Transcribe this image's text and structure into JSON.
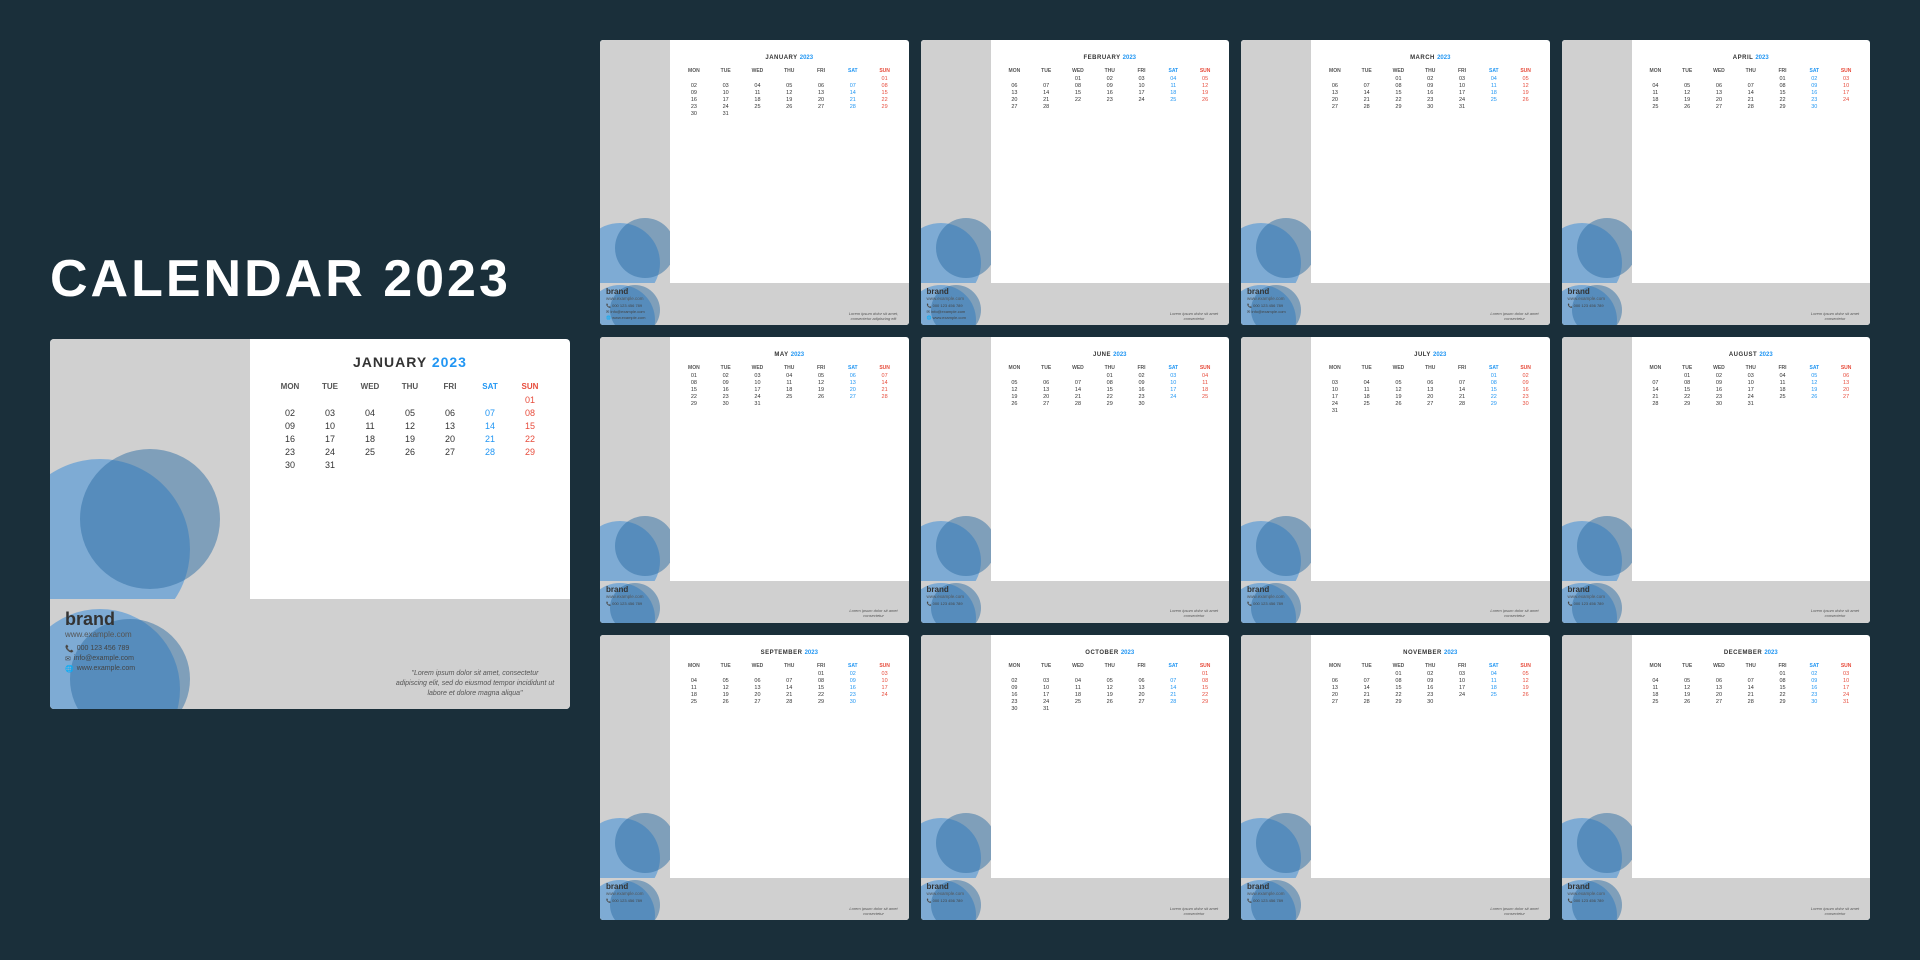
{
  "title": "CALENDAR 2023",
  "brand": {
    "name": "brand",
    "website": "www.example.com",
    "phone": "000 123 456 789",
    "email": "info@example.com",
    "web2": "www.example.com"
  },
  "quote": "\"Lorem ipsum dolor sit amet, consectetur adipiscing elit, sed do eiusmod tempor incididunt ut labore et dolore magna aliqua\"",
  "months": [
    {
      "name": "JANUARY",
      "year": "2023",
      "days": [
        "",
        "",
        "",
        "",
        "",
        "",
        "01",
        "02",
        "03",
        "04",
        "05",
        "06",
        "07",
        "08",
        "09",
        "10",
        "11",
        "12",
        "13",
        "14",
        "15",
        "16",
        "17",
        "18",
        "19",
        "20",
        "21",
        "22",
        "23",
        "24",
        "25",
        "26",
        "27",
        "28",
        "29",
        "30",
        "31",
        "",
        "",
        "",
        "",
        "",
        "",
        ""
      ]
    },
    {
      "name": "FEBRUARY",
      "year": "2023",
      "days": [
        "",
        "",
        "01",
        "02",
        "03",
        "04",
        "05",
        "06",
        "07",
        "08",
        "09",
        "10",
        "11",
        "12",
        "13",
        "14",
        "15",
        "16",
        "17",
        "18",
        "19",
        "20",
        "21",
        "22",
        "23",
        "24",
        "25",
        "26",
        "27",
        "28",
        "",
        "",
        "",
        "",
        "",
        "",
        ""
      ]
    },
    {
      "name": "MARCH",
      "year": "2023",
      "days": [
        "",
        "",
        "01",
        "02",
        "03",
        "04",
        "05",
        "06",
        "07",
        "08",
        "09",
        "10",
        "11",
        "12",
        "13",
        "14",
        "15",
        "16",
        "17",
        "18",
        "19",
        "20",
        "21",
        "22",
        "23",
        "24",
        "25",
        "26",
        "27",
        "28",
        "29",
        "30",
        "31",
        "",
        "",
        "",
        ""
      ]
    },
    {
      "name": "APRIL",
      "year": "2023",
      "days": [
        "",
        "",
        "",
        "",
        "",
        "01",
        "02",
        "03",
        "04",
        "05",
        "06",
        "07",
        "08",
        "09",
        "10",
        "11",
        "12",
        "13",
        "14",
        "15",
        "16",
        "17",
        "18",
        "19",
        "20",
        "21",
        "22",
        "23",
        "24",
        "25",
        "26",
        "27",
        "28",
        "29",
        "30",
        "",
        ""
      ]
    },
    {
      "name": "MAY",
      "year": "2023",
      "days": [
        "01",
        "02",
        "03",
        "04",
        "05",
        "06",
        "07",
        "08",
        "09",
        "10",
        "11",
        "12",
        "13",
        "14",
        "15",
        "16",
        "17",
        "18",
        "19",
        "20",
        "21",
        "22",
        "23",
        "24",
        "25",
        "26",
        "27",
        "28",
        "29",
        "30",
        "31",
        "",
        "",
        "",
        "",
        "",
        ""
      ]
    },
    {
      "name": "JUNE",
      "year": "2023",
      "days": [
        "",
        "",
        "",
        "01",
        "02",
        "03",
        "04",
        "05",
        "06",
        "07",
        "08",
        "09",
        "10",
        "11",
        "12",
        "13",
        "14",
        "15",
        "16",
        "17",
        "18",
        "19",
        "20",
        "21",
        "22",
        "23",
        "24",
        "25",
        "26",
        "27",
        "28",
        "29",
        "30",
        "",
        "",
        "",
        ""
      ]
    },
    {
      "name": "JULY",
      "year": "2023",
      "days": [
        "",
        "",
        "",
        "",
        "",
        "01",
        "02",
        "03",
        "04",
        "05",
        "06",
        "07",
        "08",
        "09",
        "10",
        "11",
        "12",
        "13",
        "14",
        "15",
        "16",
        "17",
        "18",
        "19",
        "20",
        "21",
        "22",
        "23",
        "24",
        "25",
        "26",
        "27",
        "28",
        "29",
        "30",
        "31"
      ]
    },
    {
      "name": "AUGUST",
      "year": "2023",
      "days": [
        "",
        "01",
        "02",
        "03",
        "04",
        "05",
        "06",
        "07",
        "08",
        "09",
        "10",
        "11",
        "12",
        "13",
        "14",
        "15",
        "16",
        "17",
        "18",
        "19",
        "20",
        "21",
        "22",
        "23",
        "24",
        "25",
        "26",
        "27",
        "28",
        "29",
        "30",
        "31",
        "",
        "",
        "",
        "",
        ""
      ]
    },
    {
      "name": "SEPTEMBER",
      "year": "2023",
      "days": [
        "",
        "",
        "",
        "",
        "01",
        "02",
        "03",
        "04",
        "05",
        "06",
        "07",
        "08",
        "09",
        "10",
        "11",
        "12",
        "13",
        "14",
        "15",
        "16",
        "17",
        "18",
        "19",
        "20",
        "21",
        "22",
        "23",
        "24",
        "25",
        "26",
        "27",
        "28",
        "29",
        "30",
        "",
        "",
        ""
      ]
    },
    {
      "name": "OCTOBER",
      "year": "2023",
      "days": [
        "",
        "",
        "",
        "",
        "",
        "",
        "01",
        "02",
        "03",
        "04",
        "05",
        "06",
        "07",
        "08",
        "09",
        "10",
        "11",
        "12",
        "13",
        "14",
        "15",
        "16",
        "17",
        "18",
        "19",
        "20",
        "21",
        "22",
        "23",
        "24",
        "25",
        "26",
        "27",
        "28",
        "29",
        "30",
        "31"
      ]
    },
    {
      "name": "NOVEMBER",
      "year": "2023",
      "days": [
        "",
        "",
        "01",
        "02",
        "03",
        "04",
        "05",
        "06",
        "07",
        "08",
        "09",
        "10",
        "11",
        "12",
        "13",
        "14",
        "15",
        "16",
        "17",
        "18",
        "19",
        "20",
        "21",
        "22",
        "23",
        "24",
        "25",
        "26",
        "27",
        "28",
        "29",
        "30",
        "",
        "",
        "",
        "",
        ""
      ]
    },
    {
      "name": "DECEMBER",
      "year": "2023",
      "days": [
        "",
        "",
        "",
        "",
        "01",
        "02",
        "03",
        "04",
        "05",
        "06",
        "07",
        "08",
        "09",
        "10",
        "11",
        "12",
        "13",
        "14",
        "15",
        "16",
        "17",
        "18",
        "19",
        "20",
        "21",
        "22",
        "23",
        "24",
        "25",
        "26",
        "27",
        "28",
        "29",
        "30",
        "31",
        "",
        ""
      ]
    }
  ],
  "days_header": [
    "MON",
    "TUE",
    "WED",
    "THU",
    "FRI",
    "SAT",
    "SUN"
  ],
  "colors": {
    "background": "#1a2f3a",
    "accent_blue": "#2196F3",
    "sat_blue": "#2196F3",
    "sun_red": "#e74c3c"
  }
}
